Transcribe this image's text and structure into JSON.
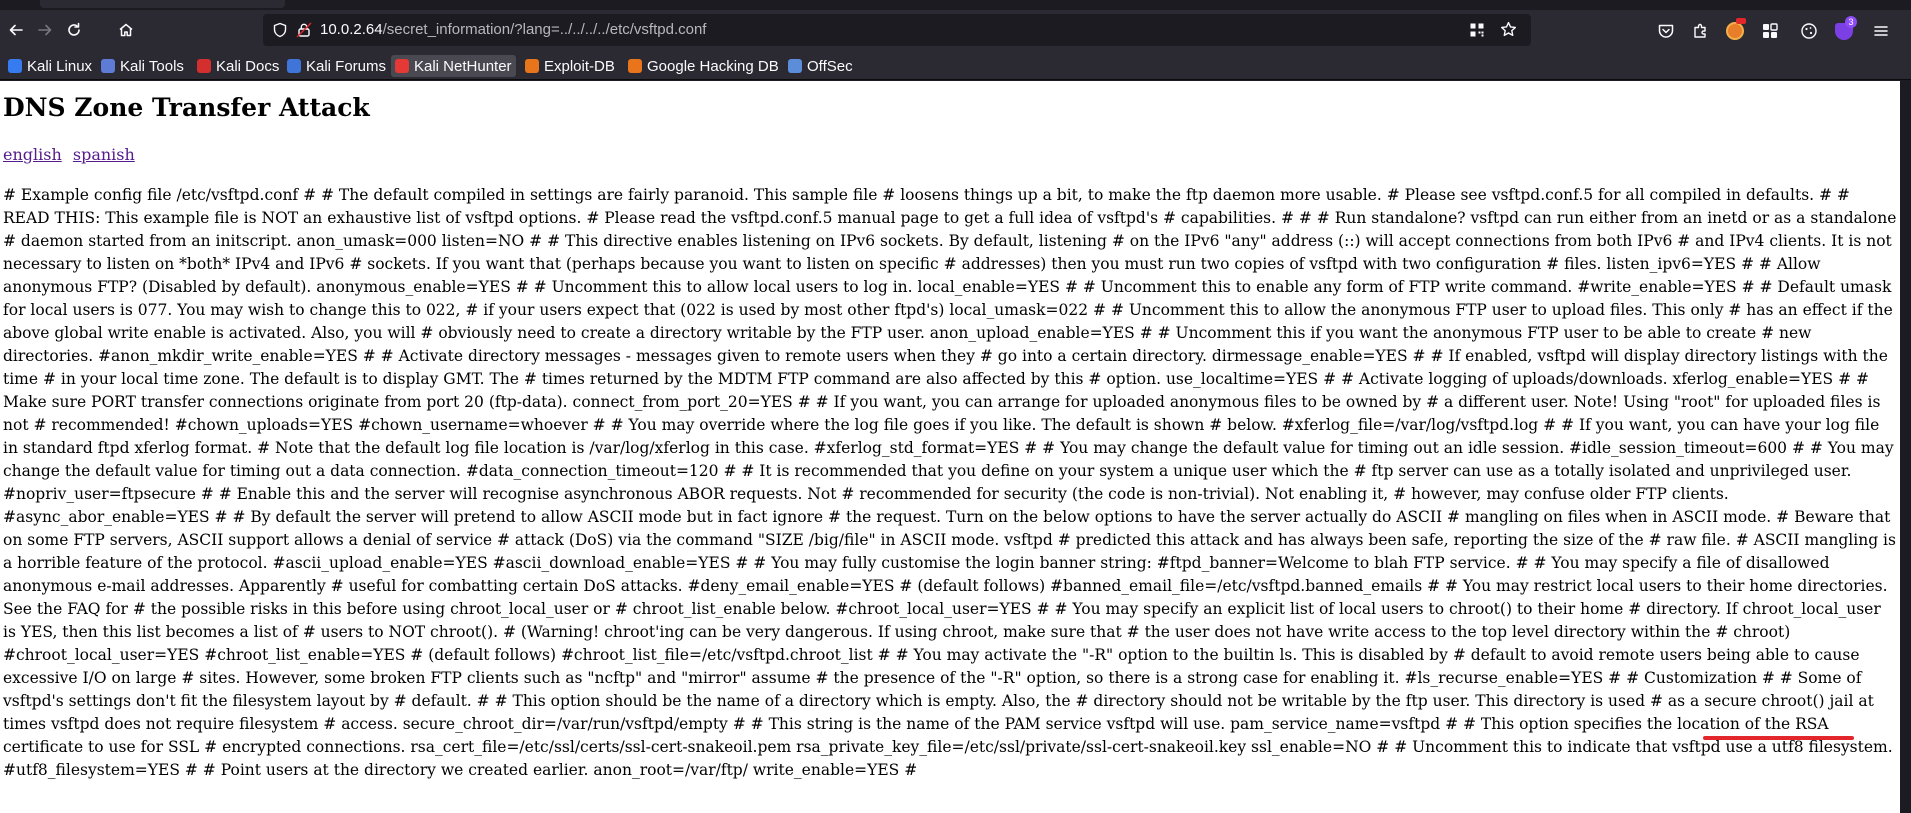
{
  "browser": {
    "url_host": "10.0.2.64",
    "url_path": "/secret_information/?lang=../../../../etc/vsftpd.conf",
    "extension_badge": "3",
    "bookmarks": [
      {
        "label": "Kali Linux",
        "color": "#367bf0"
      },
      {
        "label": "Kali Tools",
        "color": "#5e7bd6"
      },
      {
        "label": "Kali Docs",
        "color": "#d32f2f"
      },
      {
        "label": "Kali Forums",
        "color": "#3f74d9"
      },
      {
        "label": "Kali NetHunter",
        "color": "#e53935"
      },
      {
        "label": "Exploit-DB",
        "color": "#e8741c"
      },
      {
        "label": "Google Hacking DB",
        "color": "#e8741c"
      },
      {
        "label": "OffSec",
        "color": "#5b8dd9"
      }
    ]
  },
  "page": {
    "title": "DNS Zone Transfer Attack",
    "lang_links": [
      "english",
      "spanish"
    ],
    "config_text": "# Example config file /etc/vsftpd.conf # # The default compiled in settings are fairly paranoid. This sample file # loosens things up a bit, to make the ftp daemon more usable. # Please see vsftpd.conf.5 for all compiled in defaults. # # READ THIS: This example file is NOT an exhaustive list of vsftpd options. # Please read the vsftpd.conf.5 manual page to get a full idea of vsftpd's # capabilities. # # # Run standalone? vsftpd can run either from an inetd or as a standalone # daemon started from an initscript. anon_umask=000 listen=NO # # This directive enables listening on IPv6 sockets. By default, listening # on the IPv6 \"any\" address (::) will accept connections from both IPv6 # and IPv4 clients. It is not necessary to listen on *both* IPv4 and IPv6 # sockets. If you want that (perhaps because you want to listen on specific # addresses) then you must run two copies of vsftpd with two configuration # files. listen_ipv6=YES # # Allow anonymous FTP? (Disabled by default). anonymous_enable=YES # # Uncomment this to allow local users to log in. local_enable=YES # # Uncomment this to enable any form of FTP write command. #write_enable=YES # # Default umask for local users is 077. You may wish to change this to 022, # if your users expect that (022 is used by most other ftpd's) local_umask=022 # # Uncomment this to allow the anonymous FTP user to upload files. This only # has an effect if the above global write enable is activated. Also, you will # obviously need to create a directory writable by the FTP user. anon_upload_enable=YES # # Uncomment this if you want the anonymous FTP user to be able to create # new directories. #anon_mkdir_write_enable=YES # # Activate directory messages - messages given to remote users when they # go into a certain directory. dirmessage_enable=YES # # If enabled, vsftpd will display directory listings with the time # in your local time zone. The default is to display GMT. The # times returned by the MDTM FTP command are also affected by this # option. use_localtime=YES # # Activate logging of uploads/downloads. xferlog_enable=YES # # Make sure PORT transfer connections originate from port 20 (ftp-data). connect_from_port_20=YES # # If you want, you can arrange for uploaded anonymous files to be owned by # a different user. Note! Using \"root\" for uploaded files is not # recommended! #chown_uploads=YES #chown_username=whoever # # You may override where the log file goes if you like. The default is shown # below. #xferlog_file=/var/log/vsftpd.log # # If you want, you can have your log file in standard ftpd xferlog format. # Note that the default log file location is /var/log/xferlog in this case. #xferlog_std_format=YES # # You may change the default value for timing out an idle session. #idle_session_timeout=600 # # You may change the default value for timing out a data connection. #data_connection_timeout=120 # # It is recommended that you define on your system a unique user which the # ftp server can use as a totally isolated and unprivileged user. #nopriv_user=ftpsecure # # Enable this and the server will recognise asynchronous ABOR requests. Not # recommended for security (the code is non-trivial). Not enabling it, # however, may confuse older FTP clients. #async_abor_enable=YES # # By default the server will pretend to allow ASCII mode but in fact ignore # the request. Turn on the below options to have the server actually do ASCII # mangling on files when in ASCII mode. # Beware that on some FTP servers, ASCII support allows a denial of service # attack (DoS) via the command \"SIZE /big/file\" in ASCII mode. vsftpd # predicted this attack and has always been safe, reporting the size of the # raw file. # ASCII mangling is a horrible feature of the protocol. #ascii_upload_enable=YES #ascii_download_enable=YES # # You may fully customise the login banner string: #ftpd_banner=Welcome to blah FTP service. # # You may specify a file of disallowed anonymous e-mail addresses. Apparently # useful for combatting certain DoS attacks. #deny_email_enable=YES # (default follows) #banned_email_file=/etc/vsftpd.banned_emails # # You may restrict local users to their home directories. See the FAQ for # the possible risks in this before using chroot_local_user or # chroot_list_enable below. #chroot_local_user=YES # # You may specify an explicit list of local users to chroot() to their home # directory. If chroot_local_user is YES, then this list becomes a list of # users to NOT chroot(). # (Warning! chroot'ing can be very dangerous. If using chroot, make sure that # the user does not have write access to the top level directory within the # chroot) #chroot_local_user=YES #chroot_list_enable=YES # (default follows) #chroot_list_file=/etc/vsftpd.chroot_list # # You may activate the \"-R\" option to the builtin ls. This is disabled by # default to avoid remote users being able to cause excessive I/O on large # sites. However, some broken FTP clients such as \"ncftp\" and \"mirror\" assume # the presence of the \"-R\" option, so there is a strong case for enabling it. #ls_recurse_enable=YES # # Customization # # Some of vsftpd's settings don't fit the filesystem layout by # default. # # This option should be the name of a directory which is empty. Also, the # directory should not be writable by the ftp user. This directory is used # as a secure chroot() jail at times vsftpd does not require filesystem # access. secure_chroot_dir=/var/run/vsftpd/empty # # This string is the name of the PAM service vsftpd will use. pam_service_name=vsftpd # # This option specifies the location of the RSA certificate to use for SSL # encrypted connections. rsa_cert_file=/etc/ssl/certs/ssl-cert-snakeoil.pem rsa_private_key_file=/etc/ssl/private/ssl-cert-snakeoil.key ssl_enable=NO # # Uncomment this to indicate that vsftpd use a utf8 filesystem. #utf8_filesystem=YES # # Point users at the directory we created earlier. anon_root=/var/ftp/ write_enable=YES #",
    "highlight_color": "#e3262b"
  }
}
